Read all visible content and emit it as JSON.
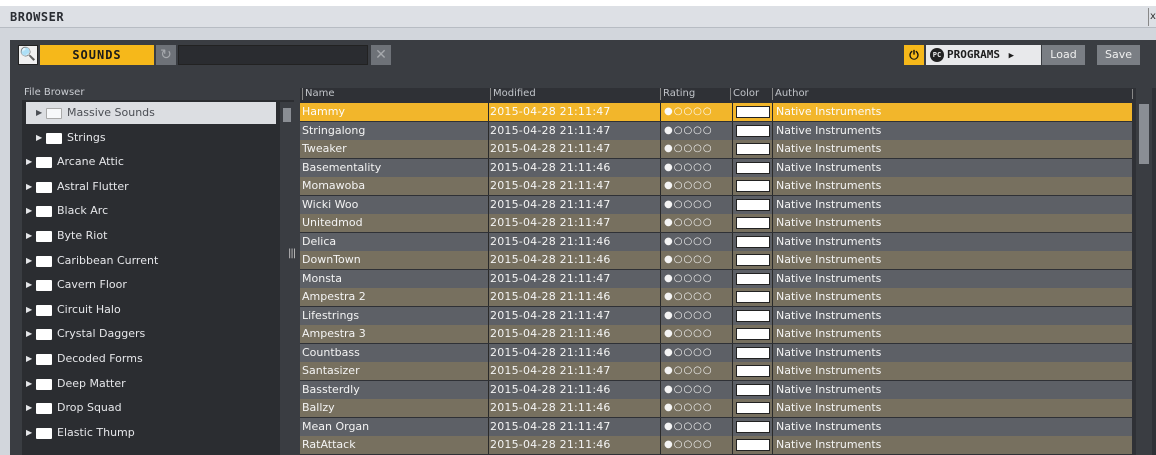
{
  "window": {
    "title": "BROWSER",
    "close_glyph": "x"
  },
  "toolbar": {
    "search_icon": "🔍",
    "sounds_label": "SOUNDS",
    "reset_glyph": "↻",
    "search_value": "",
    "clear_glyph": "✕",
    "power_glyph": "⏻",
    "programs_logo": "PC",
    "programs_label": "PROGRAMS",
    "programs_arrow": "▶",
    "load_label": "Load",
    "save_label": "Save",
    "accent_color": "#f6b81a"
  },
  "file_browser": {
    "header": "File Browser",
    "items": [
      {
        "label": "Massive Sounds",
        "selected": true,
        "indent": 1
      },
      {
        "label": "Strings",
        "selected": false,
        "indent": 1
      },
      {
        "label": "Arcane Attic",
        "selected": false,
        "indent": 0
      },
      {
        "label": "Astral Flutter",
        "selected": false,
        "indent": 0
      },
      {
        "label": "Black Arc",
        "selected": false,
        "indent": 0
      },
      {
        "label": "Byte Riot",
        "selected": false,
        "indent": 0
      },
      {
        "label": "Caribbean Current",
        "selected": false,
        "indent": 0
      },
      {
        "label": "Cavern Floor",
        "selected": false,
        "indent": 0
      },
      {
        "label": "Circuit Halo",
        "selected": false,
        "indent": 0
      },
      {
        "label": "Crystal Daggers",
        "selected": false,
        "indent": 0
      },
      {
        "label": "Decoded Forms",
        "selected": false,
        "indent": 0
      },
      {
        "label": "Deep Matter",
        "selected": false,
        "indent": 0
      },
      {
        "label": "Drop Squad",
        "selected": false,
        "indent": 0
      },
      {
        "label": "Elastic Thump",
        "selected": false,
        "indent": 0
      }
    ]
  },
  "table": {
    "columns": {
      "name": "Name",
      "modified": "Modified",
      "rating": "Rating",
      "color": "Color",
      "author": "Author"
    },
    "rating_glyphs": "●○○○○",
    "rows": [
      {
        "name": "Hammy",
        "modified": "2015-04-28 21:11:47",
        "author": "Native Instruments",
        "selected": true
      },
      {
        "name": "Stringalong",
        "modified": "2015-04-28 21:11:47",
        "author": "Native Instruments"
      },
      {
        "name": "Tweaker",
        "modified": "2015-04-28 21:11:47",
        "author": "Native Instruments"
      },
      {
        "name": "Basementality",
        "modified": "2015-04-28 21:11:46",
        "author": "Native Instruments"
      },
      {
        "name": "Momawoba",
        "modified": "2015-04-28 21:11:47",
        "author": "Native Instruments"
      },
      {
        "name": "Wicki Woo",
        "modified": "2015-04-28 21:11:47",
        "author": "Native Instruments"
      },
      {
        "name": "Unitedmod",
        "modified": "2015-04-28 21:11:47",
        "author": "Native Instruments"
      },
      {
        "name": "Delica",
        "modified": "2015-04-28 21:11:46",
        "author": "Native Instruments"
      },
      {
        "name": "DownTown",
        "modified": "2015-04-28 21:11:46",
        "author": "Native Instruments"
      },
      {
        "name": "Monsta",
        "modified": "2015-04-28 21:11:47",
        "author": "Native Instruments"
      },
      {
        "name": "Ampestra 2",
        "modified": "2015-04-28 21:11:46",
        "author": "Native Instruments"
      },
      {
        "name": "Lifestrings",
        "modified": "2015-04-28 21:11:47",
        "author": "Native Instruments"
      },
      {
        "name": "Ampestra 3",
        "modified": "2015-04-28 21:11:46",
        "author": "Native Instruments"
      },
      {
        "name": "Countbass",
        "modified": "2015-04-28 21:11:46",
        "author": "Native Instruments"
      },
      {
        "name": "Santasizer",
        "modified": "2015-04-28 21:11:47",
        "author": "Native Instruments"
      },
      {
        "name": "Bassterdly",
        "modified": "2015-04-28 21:11:46",
        "author": "Native Instruments"
      },
      {
        "name": "Ballzy",
        "modified": "2015-04-28 21:11:46",
        "author": "Native Instruments"
      },
      {
        "name": "Mean Organ",
        "modified": "2015-04-28 21:11:47",
        "author": "Native Instruments"
      },
      {
        "name": "RatAttack",
        "modified": "2015-04-28 21:11:46",
        "author": "Native Instruments"
      }
    ],
    "colors": {
      "selected_row": "#f2b62b",
      "row_even": "#5d6066",
      "row_odd": "#77705f"
    }
  }
}
